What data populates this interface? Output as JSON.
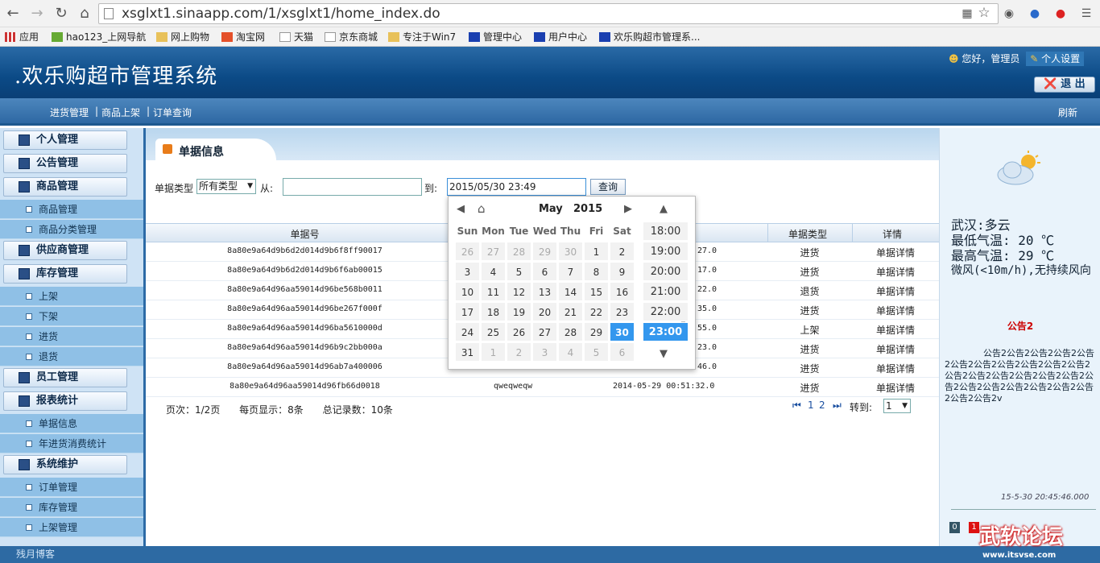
{
  "browser": {
    "url": "xsglxt1.sinaapp.com/1/xsglxt1/home_index.do",
    "bookmarks": [
      "应用",
      "hao123_上网导航",
      "网上购物",
      "淘宝网",
      "天猫",
      "京东商城",
      "专注于Win7",
      "管理中心",
      "用户中心",
      "欢乐购超市管理系..."
    ]
  },
  "header": {
    "title": ".欢乐购超市管理系统",
    "greeting": "您好，管理员",
    "settings": "个人设置",
    "logout": "退 出"
  },
  "menubar": {
    "items": [
      "进货管理",
      "商品上架",
      "订单查询"
    ],
    "separator": "|",
    "refresh": "刷新"
  },
  "sidebar": {
    "groups": [
      "个人管理",
      "公告管理",
      "商品管理",
      "供应商管理",
      "库存管理",
      "员工管理",
      "报表统计",
      "系统维护"
    ],
    "items": {
      "goods": [
        "商品管理",
        "商品分类管理"
      ],
      "stock": [
        "上架",
        "下架",
        "进货",
        "退货"
      ],
      "report": [
        "单据信息",
        "年进货消费统计"
      ],
      "system": [
        "订单管理",
        "库存管理",
        "上架管理"
      ]
    }
  },
  "main": {
    "tab_title": "单据信息",
    "filter": {
      "type_label": "单据类型",
      "type_value": "所有类型",
      "from_label": "从:",
      "from_value": "",
      "to_label": "到:",
      "to_value": "2015/05/30 23:49",
      "query_button": "查询"
    },
    "table": {
      "headers": [
        "单据号",
        "单据类型",
        "详情"
      ],
      "rows": [
        {
          "id": "8a80e9a64d9b6d2d014d9b6f8ff90017",
          "time_tail": "27.0",
          "type": "进货",
          "detail": "单据详情"
        },
        {
          "id": "8a80e9a64d9b6d2d014d9b6f6ab00015",
          "time_tail": "17.0",
          "type": "进货",
          "detail": "单据详情"
        },
        {
          "id": "8a80e9a64d96aa59014d96be568b0011",
          "time_tail": "22.0",
          "type": "退货",
          "detail": "单据详情"
        },
        {
          "id": "8a80e9a64d96aa59014d96be267f000f",
          "time_tail": "35.0",
          "type": "进货",
          "detail": "单据详情"
        },
        {
          "id": "8a80e9a64d96aa59014d96ba5610000d",
          "time_tail": "55.0",
          "type": "上架",
          "detail": "单据详情"
        },
        {
          "id": "8a80e9a64d96aa59014d96b9c2bb000a",
          "time_tail": "23.0",
          "type": "进货",
          "detail": "单据详情"
        },
        {
          "id": "8a80e9a64d96aa59014d96ab7a400006",
          "time_tail": "46.0",
          "type": "进货",
          "detail": "单据详情"
        },
        {
          "id": "8a80e9a64d96aa59014d96fb66d0018",
          "op": "qweqweqw",
          "time": "2014-05-29 00:51:32.0",
          "type": "进货",
          "detail": "单据详情"
        }
      ]
    },
    "pager": {
      "page": "页次：1/2页",
      "per_page": "每页显示：8条",
      "total": "总记录数：10条",
      "pages": [
        "1",
        "2"
      ],
      "goto_label": "转到:",
      "goto_value": "1"
    }
  },
  "calendar": {
    "month": "May",
    "year": "2015",
    "weekdays": [
      "Sun",
      "Mon",
      "Tue",
      "Wed",
      "Thu",
      "Fri",
      "Sat"
    ],
    "weeks": [
      [
        "26",
        "27",
        "28",
        "29",
        "30",
        "1",
        "2"
      ],
      [
        "3",
        "4",
        "5",
        "6",
        "7",
        "8",
        "9"
      ],
      [
        "10",
        "11",
        "12",
        "13",
        "14",
        "15",
        "16"
      ],
      [
        "17",
        "18",
        "19",
        "20",
        "21",
        "22",
        "23"
      ],
      [
        "24",
        "25",
        "26",
        "27",
        "28",
        "29",
        "30"
      ],
      [
        "31",
        "1",
        "2",
        "3",
        "4",
        "5",
        "6"
      ]
    ],
    "selected_day": "30",
    "times": [
      "18:00",
      "19:00",
      "20:00",
      "21:00",
      "22:00",
      "23:00"
    ],
    "selected_time": "23:00"
  },
  "weather": {
    "city": "武汉:多云",
    "low": "最低气温: 20 ℃",
    "high": "最高气温: 29 ℃",
    "wind": "微风(<10m/h),无持续风向"
  },
  "notice": {
    "title": "公告2",
    "body": "公告2公告2公告2公告2公告2公告2公告2公告2公告2公告2公告2公告2公告2公告2公告2公告2公告2公告2公告2公告2公告2公告2公告2公告2公告2公告2v",
    "timestamp": "15-5-30 20:45:46.000",
    "badge_a": "0",
    "badge_b": "1"
  },
  "footer": "残月博客",
  "watermark": {
    "text": "武软论坛",
    "url": "www.itsvse.com"
  },
  "colors": {
    "accent": "#3397ee",
    "header": "#0b4a86",
    "sidebar": "#8fc0e6"
  }
}
